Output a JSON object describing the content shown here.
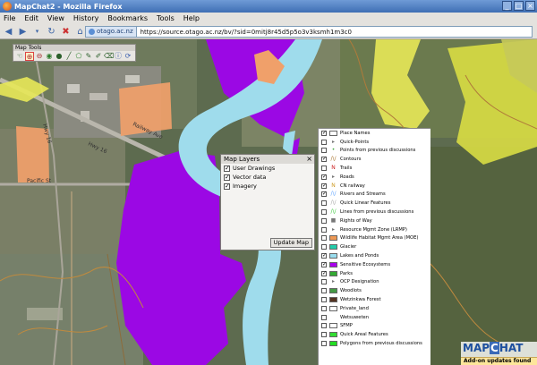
{
  "window": {
    "title": "MapChat2 - Mozilla Firefox",
    "buttons": [
      "_",
      "□",
      "×"
    ]
  },
  "menu": [
    "File",
    "Edit",
    "View",
    "History",
    "Bookmarks",
    "Tools",
    "Help"
  ],
  "nav": {
    "site": "otago.ac.nz",
    "url": "https://source.otago.ac.nz/bv/?sid=0mitj8r45d5p5o3v3ksmh1m3c0"
  },
  "map_tools": {
    "title": "Map Tools"
  },
  "map_layers": {
    "title": "Map Layers",
    "layers": [
      {
        "label": "User Drawings",
        "checked": true
      },
      {
        "label": "Vector data",
        "checked": true
      },
      {
        "label": "Imagery",
        "checked": true
      }
    ],
    "update_label": "Update Map"
  },
  "legend": [
    {
      "label": "Place Names",
      "checked": true,
      "color": "#ffffff",
      "glyph": ""
    },
    {
      "label": "Quick-Points",
      "checked": false,
      "color": "#777777",
      "glyph": "▸"
    },
    {
      "label": "Points from previous discussions",
      "checked": false,
      "color": "#44aa44",
      "glyph": "•"
    },
    {
      "label": "Contours",
      "checked": true,
      "color": "#aa7733",
      "glyph": "/\\/"
    },
    {
      "label": "Trails",
      "checked": false,
      "color": "#cc2222",
      "glyph": "N"
    },
    {
      "label": "Roads",
      "checked": true,
      "color": "#777777",
      "glyph": "▸"
    },
    {
      "label": "CN railway",
      "checked": true,
      "color": "#cc9922",
      "glyph": "N"
    },
    {
      "label": "Rivers and Streams",
      "checked": true,
      "color": "#66aaff",
      "glyph": "/\\/"
    },
    {
      "label": "Quick Linear Features",
      "checked": false,
      "color": "#aaaaaa",
      "glyph": "/\\/"
    },
    {
      "label": "Lines from previous discussions",
      "checked": false,
      "color": "#44cc44",
      "glyph": "/\\/"
    },
    {
      "label": "Rights of Way",
      "checked": false,
      "color": "#777777",
      "glyph": "■"
    },
    {
      "label": "Resource Mgmt Zone (LRMP)",
      "checked": false,
      "color": "#777777",
      "glyph": "▸"
    },
    {
      "label": "Wildlife Habitat Mgmt Area (MOE)",
      "checked": false,
      "color": "#ee9955",
      "glyph": ""
    },
    {
      "label": "Glacier",
      "checked": false,
      "color": "#22ccaa",
      "glyph": ""
    },
    {
      "label": "Lakes and Ponds",
      "checked": true,
      "color": "#99ddee",
      "glyph": ""
    },
    {
      "label": "Sensitive Ecosystems",
      "checked": true,
      "color": "#aa00ee",
      "glyph": ""
    },
    {
      "label": "Parks",
      "checked": true,
      "color": "#33aa33",
      "glyph": ""
    },
    {
      "label": "OCP Designation",
      "checked": false,
      "color": "#777777",
      "glyph": "▸"
    },
    {
      "label": "Woodlots",
      "checked": false,
      "color": "#449944",
      "glyph": ""
    },
    {
      "label": "Wetzinkwa Forest",
      "checked": false,
      "color": "#553322",
      "glyph": ""
    },
    {
      "label": "Private_land",
      "checked": false,
      "color": "#ffffff",
      "glyph": ""
    },
    {
      "label": "Wetsuweten",
      "checked": false,
      "color": "#ffffff",
      "glyph": "/"
    },
    {
      "label": "SFMP",
      "checked": false,
      "color": "#ffffff",
      "glyph": ""
    },
    {
      "label": "Quick Areal Features",
      "checked": false,
      "color": "#33dd33",
      "glyph": ""
    },
    {
      "label": "Polygons from previous discussions",
      "checked": false,
      "color": "#22dd22",
      "glyph": ""
    }
  ],
  "map_labels": {
    "road1": "Hwy 16",
    "road2": "Hwy 16",
    "road3": "Pacific St",
    "road4": "Railway Ave"
  },
  "brand": {
    "left": "MAP",
    "c": "C",
    "right": "HAT"
  },
  "notification": "Add-on updates found"
}
